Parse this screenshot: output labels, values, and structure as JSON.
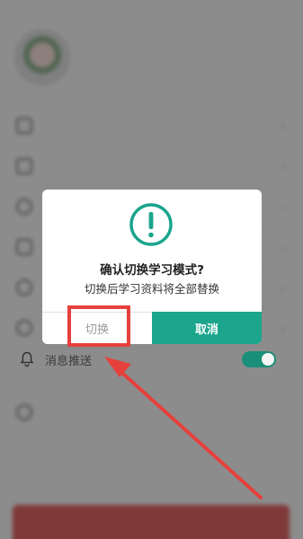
{
  "dialog": {
    "title": "确认切换学习模式?",
    "subtitle": "切换后学习资料将全部替换",
    "switch_label": "切换",
    "cancel_label": "取消",
    "icon": "exclamation-circle-icon"
  },
  "settings": {
    "notification_label": "消息推送",
    "notification_enabled": true
  },
  "colors": {
    "accent": "#1aa58c",
    "annotation": "#e6403c"
  }
}
